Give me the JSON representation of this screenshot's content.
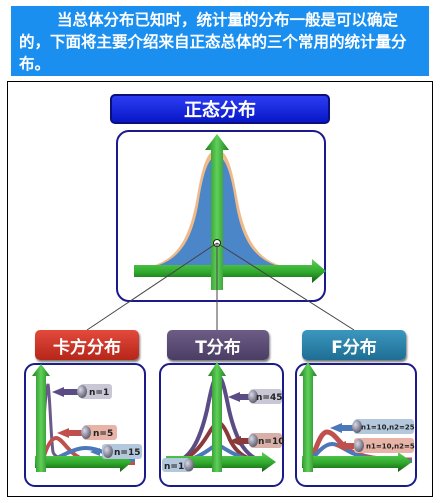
{
  "header": {
    "text": "当总体分布已知时，统计量的分布一般是可以确定的，下面将主要介绍来自正态总体的三个常用的统计量分布。"
  },
  "main": {
    "title": "正态分布"
  },
  "distributions": {
    "chi": {
      "title": "卡方分布",
      "labels": [
        "n=1",
        "n=5",
        "n=15"
      ]
    },
    "t": {
      "title": "T分布",
      "labels": [
        "n=45",
        "n=10",
        "n=1"
      ]
    },
    "f": {
      "title": "F分布",
      "labels": [
        "n1=10,n2=25",
        "n1=10,n2=5"
      ]
    }
  },
  "colors": {
    "header_bg": "#1b8ff0",
    "arrow_green": "#2fa82c",
    "panel_border": "#1a1a8c",
    "chi_title": "#c9372a",
    "t_title": "#5a4c73",
    "f_title": "#2a82aa",
    "curve_blue": "#4a78b8",
    "curve_red": "#c0504d",
    "curve_purple": "#5b4c86",
    "curve_brown": "#8a3a3a"
  }
}
